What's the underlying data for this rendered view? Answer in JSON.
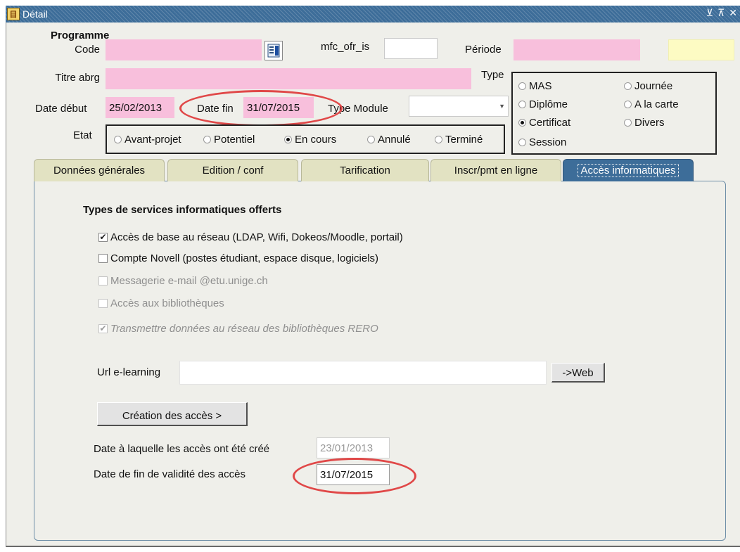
{
  "window": {
    "title": "Détail",
    "controls": [
      "⊻",
      "⊼",
      "✕"
    ]
  },
  "programme": {
    "section_label": "Programme",
    "code_label": "Code",
    "code_value": "",
    "mfc_label": "mfc_ofr_is",
    "mfc_value": "",
    "periode_label": "Période",
    "periode_value": "",
    "extra_value": "",
    "titre_label": "Titre abrg",
    "titre_value": "",
    "type_label": "Type",
    "date_debut_label": "Date début",
    "date_debut_value": "25/02/2013",
    "date_fin_label": "Date fin",
    "date_fin_value": "31/07/2015",
    "type_module_label": "Type Module",
    "type_module_value": "",
    "etat_label": "Etat"
  },
  "type_options": [
    {
      "label": "MAS",
      "selected": false
    },
    {
      "label": "Journée",
      "selected": false
    },
    {
      "label": "Diplôme",
      "selected": false
    },
    {
      "label": "A la carte",
      "selected": false
    },
    {
      "label": "Certificat",
      "selected": true
    },
    {
      "label": "Divers",
      "selected": false
    },
    {
      "label": "Session",
      "selected": false
    }
  ],
  "etat_options": [
    {
      "label": "Avant-projet",
      "selected": false
    },
    {
      "label": "Potentiel",
      "selected": false
    },
    {
      "label": "En cours",
      "selected": true
    },
    {
      "label": "Annulé",
      "selected": false
    },
    {
      "label": "Terminé",
      "selected": false
    }
  ],
  "tabs": [
    {
      "label": "Données générales",
      "active": false
    },
    {
      "label": "Edition / conf",
      "active": false
    },
    {
      "label": "Tarification",
      "active": false
    },
    {
      "label": "Inscr/pmt en ligne",
      "active": false
    },
    {
      "label": "Accès informatiques",
      "active": true
    }
  ],
  "services": {
    "heading": "Types de services informatiques offerts",
    "items": [
      {
        "label": "Accès de base au réseau (LDAP, Wifi, Dokeos/Moodle, portail)",
        "checked": true,
        "enabled": true
      },
      {
        "label": "Compte Novell (postes étudiant, espace disque, logiciels)",
        "checked": false,
        "enabled": true
      },
      {
        "label": "Messagerie e-mail @etu.unige.ch",
        "checked": false,
        "enabled": false
      },
      {
        "label": "Accès aux bibliothèques",
        "checked": false,
        "enabled": false
      },
      {
        "label": "Transmettre données au réseau des bibliothèques RERO",
        "checked": true,
        "enabled": false
      }
    ]
  },
  "elearning": {
    "url_label": "Url e-learning",
    "url_value": "",
    "web_button": "->Web"
  },
  "creation_button": "Création des accès >",
  "dates": {
    "created_label": "Date à laquelle les accès ont été créé",
    "created_value": "23/01/2013",
    "validity_label": "Date de fin de validité des accès",
    "validity_value": "31/07/2015"
  },
  "colors": {
    "required_field": "#f8bfdc",
    "highlight_field": "#fdfbc3",
    "active_tab": "#3d6d99",
    "annotation": "#e04848"
  }
}
